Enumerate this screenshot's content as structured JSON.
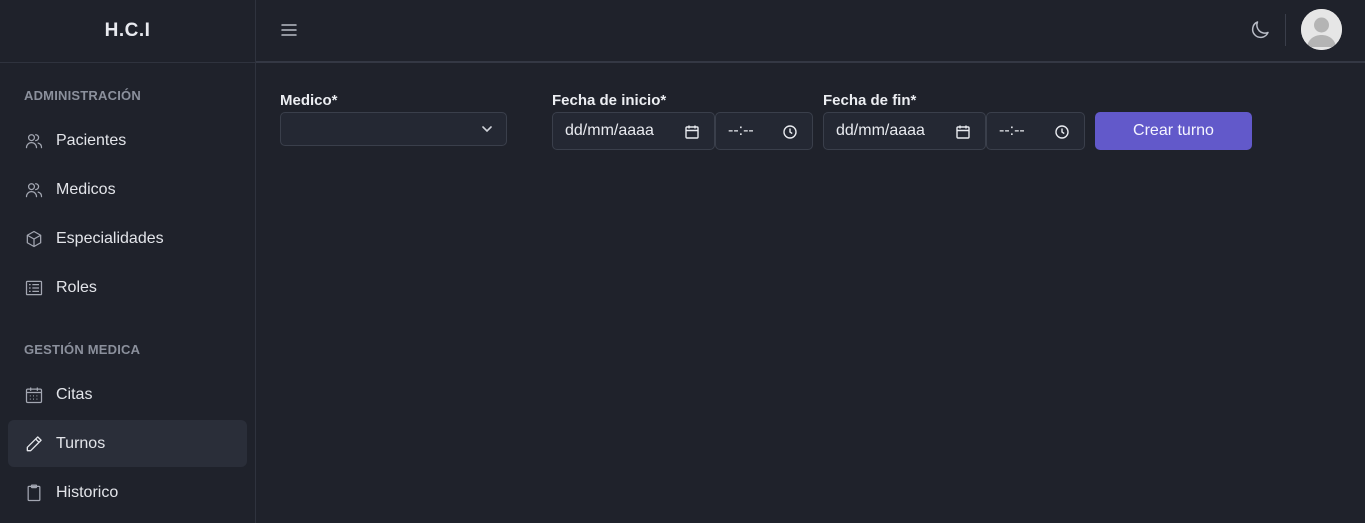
{
  "app": {
    "brand": "H.C.I"
  },
  "sidebar": {
    "sections": [
      {
        "title": "ADMINISTRACIÓN",
        "items": [
          {
            "label": "Pacientes",
            "icon": "users-icon"
          },
          {
            "label": "Medicos",
            "icon": "users-icon"
          },
          {
            "label": "Especialidades",
            "icon": "cube-icon"
          },
          {
            "label": "Roles",
            "icon": "list-icon"
          }
        ]
      },
      {
        "title": "GESTIÓN MEDICA",
        "items": [
          {
            "label": "Citas",
            "icon": "calendar-icon"
          },
          {
            "label": "Turnos",
            "icon": "pencil-icon",
            "active": true
          },
          {
            "label": "Historico",
            "icon": "clipboard-icon"
          }
        ]
      }
    ]
  },
  "form": {
    "medico_label": "Medico*",
    "medico_value": "",
    "fecha_inicio_label": "Fecha de inicio*",
    "fecha_inicio_date": "dd/mm/aaaa",
    "fecha_inicio_time": "--:--",
    "fecha_fin_label": "Fecha de fin*",
    "fecha_fin_date": "dd/mm/aaaa",
    "fecha_fin_time": "--:--",
    "submit_label": "Crear turno"
  },
  "colors": {
    "background": "#1f222b",
    "accent": "#6259ca",
    "active_item": "#2a2e39"
  }
}
